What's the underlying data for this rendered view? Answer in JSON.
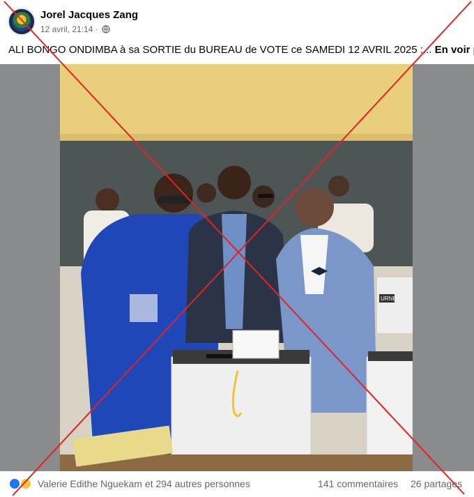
{
  "post": {
    "author": "Jorel Jacques Zang",
    "timestamp": "12 avril, 21:14 ·",
    "caption": "ALI BONGO ONDIMBA à sa SORTIE du BUREAU de VOTE ce SAMEDI 12 AVRIL 2025 :...",
    "see_more": "En voir plus",
    "photo_label": "URNE"
  },
  "footer": {
    "reactions": "Valerie Edithe Nguekam et 294 autres personnes",
    "comments": "141 commentaires",
    "shares": "26 partages"
  },
  "colors": {
    "accent": "#1877f2",
    "cross": "#e32322",
    "text_secondary": "#65676b"
  },
  "icons": [
    "globe-icon",
    "like-reaction-icon",
    "haha-reaction-icon"
  ]
}
